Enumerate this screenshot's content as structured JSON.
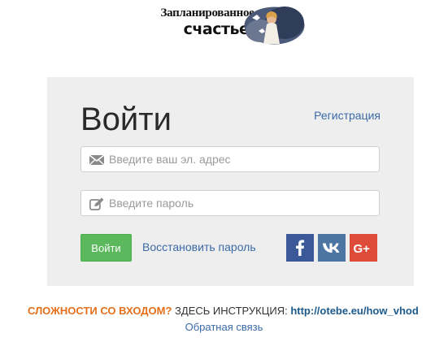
{
  "logo": {
    "line1": "Запланированное",
    "line2": "счастье"
  },
  "login": {
    "title": "Войти",
    "register_link": "Регистрация",
    "email_placeholder": "Введите ваш эл. адрес",
    "password_placeholder": "Введите пароль",
    "submit_label": "Войти",
    "restore_link": "Восстановить пароль"
  },
  "social": {
    "facebook_icon": "facebook-icon",
    "vk_icon": "vk-icon",
    "google_plus_icon": "google-plus-icon",
    "facebook_label": "f",
    "vk_label": "vk",
    "google_plus_label": "G+",
    "colors": {
      "facebook": "#3b5998",
      "vk": "#4c75a3",
      "google_plus": "#dd4b39"
    }
  },
  "help": {
    "warning": "СЛОЖНОСТИ СО ВХОДОМ?",
    "instruction": " ЗДЕСЬ ИНСТРУКЦИЯ: ",
    "url": "http://otebe.eu/how_vhod",
    "feedback_link": "Обратная связь"
  },
  "colors": {
    "accent_green": "#5cb85c",
    "link_blue": "#3b6aa8",
    "warning_orange": "#e46f1a",
    "panel_bg": "#eeeeee"
  }
}
